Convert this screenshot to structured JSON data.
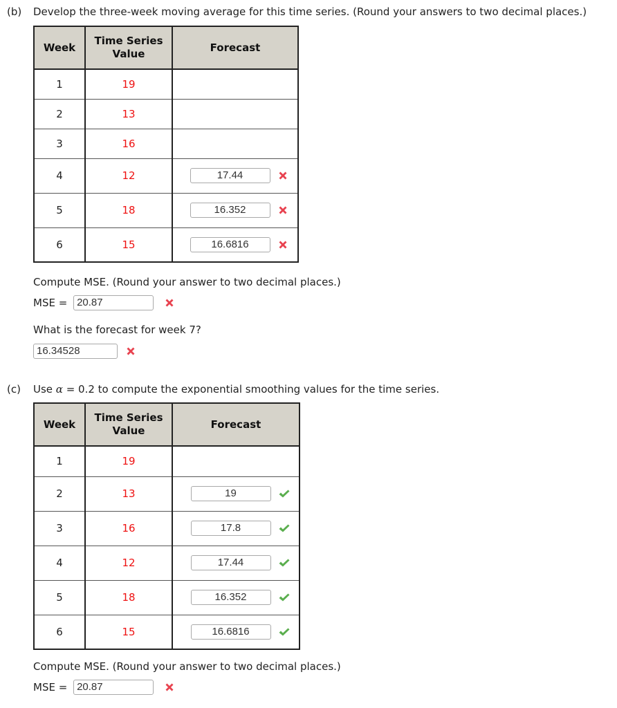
{
  "part_b": {
    "label": "(b)",
    "prompt": "Develop the three-week moving average for this time series. (Round your answers to two decimal places.)",
    "table": {
      "headers": [
        "Week",
        "Time Series Value",
        "Forecast"
      ],
      "header_time_series_line1": "Time Series",
      "header_time_series_line2": "Value",
      "rows": [
        {
          "week": "1",
          "value": "19",
          "forecast": null,
          "status": null
        },
        {
          "week": "2",
          "value": "13",
          "forecast": null,
          "status": null
        },
        {
          "week": "3",
          "value": "16",
          "forecast": null,
          "status": null
        },
        {
          "week": "4",
          "value": "12",
          "forecast": "17.44",
          "status": "incorrect"
        },
        {
          "week": "5",
          "value": "18",
          "forecast": "16.352",
          "status": "incorrect"
        },
        {
          "week": "6",
          "value": "15",
          "forecast": "16.6816",
          "status": "incorrect"
        }
      ]
    },
    "mse_prompt": "Compute MSE. (Round your answer to two decimal places.)",
    "mse_label": "MSE =",
    "mse_value": "20.87",
    "mse_status": "incorrect",
    "week7_prompt": "What is the forecast for week 7?",
    "week7_value": "16.34528",
    "week7_status": "incorrect"
  },
  "part_c": {
    "label": "(c)",
    "prompt_before": "Use ",
    "alpha_symbol": "α",
    "prompt_after": " = 0.2 to compute the exponential smoothing values for the time series.",
    "table": {
      "headers": [
        "Week",
        "Time Series Value",
        "Forecast"
      ],
      "header_time_series_line1": "Time Series",
      "header_time_series_line2": "Value",
      "rows": [
        {
          "week": "1",
          "value": "19",
          "forecast": null,
          "status": null
        },
        {
          "week": "2",
          "value": "13",
          "forecast": "19",
          "status": "correct"
        },
        {
          "week": "3",
          "value": "16",
          "forecast": "17.8",
          "status": "correct"
        },
        {
          "week": "4",
          "value": "12",
          "forecast": "17.44",
          "status": "correct"
        },
        {
          "week": "5",
          "value": "18",
          "forecast": "16.352",
          "status": "correct"
        },
        {
          "week": "6",
          "value": "15",
          "forecast": "16.6816",
          "status": "correct"
        }
      ]
    },
    "mse_prompt": "Compute MSE. (Round your answer to two decimal places.)",
    "mse_label": "MSE =",
    "mse_value": "20.87",
    "mse_status": "incorrect"
  },
  "colors": {
    "value_text": "#ee1111",
    "header_bg": "#d6d3ca",
    "incorrect_mark": "#e8424f",
    "correct_mark": "#5aae4e"
  },
  "icons": {
    "incorrect": "x-mark-icon",
    "correct": "check-mark-icon"
  }
}
